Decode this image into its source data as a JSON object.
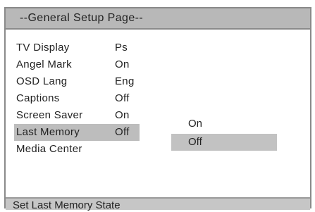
{
  "header": {
    "title": "--General Setup Page--"
  },
  "menu": {
    "items": [
      {
        "label": "TV Display",
        "value": "Ps"
      },
      {
        "label": "Angel Mark",
        "value": "On"
      },
      {
        "label": "OSD Lang",
        "value": "Eng"
      },
      {
        "label": "Captions",
        "value": "Off"
      },
      {
        "label": "Screen Saver",
        "value": "On"
      },
      {
        "label": "Last Memory",
        "value": "Off"
      },
      {
        "label": "Media Center",
        "value": ""
      }
    ],
    "selected_label": "Last Memory"
  },
  "submenu": {
    "options": [
      {
        "label": "On"
      },
      {
        "label": "Off"
      }
    ],
    "selected_label": "Off"
  },
  "status_bar": {
    "text": "Set Last Memory State"
  },
  "colors": {
    "title_bar": "#b8b8b8",
    "highlight": "#bdbdbd",
    "status_bar": "#c6c6c6",
    "border": "#8a8a8a"
  }
}
